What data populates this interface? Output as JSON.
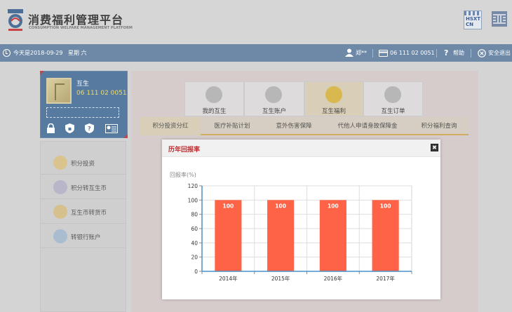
{
  "brand": {
    "title": "消费福利管理平台",
    "subtitle": "CONSUMPTION WELFARE MANAGEMENT PLATFORM",
    "badge": "HSXT\nCN"
  },
  "topbar": {
    "date_text": "今天是2018-09-29",
    "weekday": "星期 六",
    "user": "郑**",
    "card_number": "06 111 02 0051",
    "help": "帮助",
    "logout": "安全退出"
  },
  "profile": {
    "name": "互生",
    "number": "06 111 02 0051"
  },
  "sidebar": {
    "items": [
      {
        "label": "积分投资",
        "icon": "coin-icon"
      },
      {
        "label": "积分转互生币",
        "icon": "exchange-icon"
      },
      {
        "label": "互生币转货币",
        "icon": "convert-icon"
      },
      {
        "label": "转银行账户",
        "icon": "bank-card-icon"
      }
    ]
  },
  "main_tabs": [
    {
      "label": "我的互生",
      "icon": "user-icon"
    },
    {
      "label": "互生账户",
      "icon": "account-icon"
    },
    {
      "label": "互生福利",
      "icon": "gift-icon",
      "active": true
    },
    {
      "label": "互生订单",
      "icon": "order-icon"
    }
  ],
  "sub_tabs": [
    {
      "label": "积分投资分红",
      "active": true
    },
    {
      "label": "医疗补贴计划"
    },
    {
      "label": "意外伤害保障"
    },
    {
      "label": "代他人申请身故保障金"
    },
    {
      "label": "积分福利查询"
    }
  ],
  "modal": {
    "title": "历年回报率",
    "close_label": "✖"
  },
  "chart_data": {
    "type": "bar",
    "ylabel": "回报率(%)",
    "categories": [
      "2014年",
      "2015年",
      "2016年",
      "2017年"
    ],
    "values": [
      100,
      100,
      100,
      100
    ],
    "ylim": [
      0,
      120
    ],
    "yticks": [
      0,
      20,
      40,
      60,
      80,
      100,
      120
    ],
    "grid": true,
    "bar_color": "#ff6347"
  },
  "colors": {
    "topbar": "#6e89a8",
    "profile_panel": "#567aa0",
    "accent_gold": "#d2ad61",
    "modal_title": "#c6282c"
  }
}
